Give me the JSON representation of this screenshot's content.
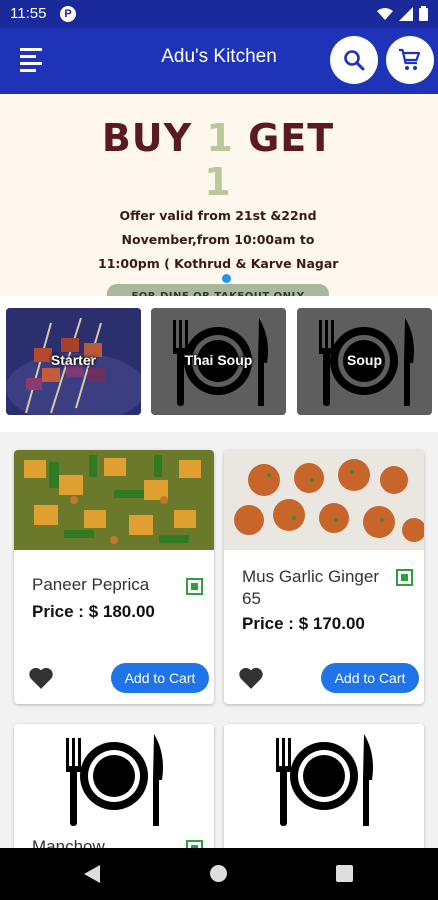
{
  "status_bar": {
    "time": "11:55",
    "notification_badge": "P"
  },
  "app_bar": {
    "title": "Adu's Kitchen"
  },
  "banner": {
    "headline_a": "BUY ",
    "headline_one_a": "1",
    "headline_b": " GET ",
    "headline_one_b": "1",
    "line1": "Offer valid from 21st &22nd",
    "line2": "November,from 10:00am to",
    "line3": "11:00pm ( Kothrud & Karve Nagar",
    "pill": "FOR DINE OR TAKEOUT ONLY"
  },
  "categories": [
    {
      "label": "Starter"
    },
    {
      "label": "Thai Soup"
    },
    {
      "label": "Soup"
    }
  ],
  "products": [
    {
      "name": "Paneer Peprica",
      "price": "Price : $ 180.00",
      "button": "Add to Cart"
    },
    {
      "name": "Mus Garlic Ginger 65",
      "price": "Price : $ 170.00",
      "button": "Add to Cart"
    },
    {
      "name": "Manchow ...",
      "price": "",
      "button": ""
    },
    {
      "name": "",
      "price": "",
      "button": ""
    }
  ],
  "colors": {
    "primary": "#1f33b8",
    "accent": "#1e74e8",
    "veg": "#2e9e3e",
    "banner_text": "#5a1a25"
  }
}
